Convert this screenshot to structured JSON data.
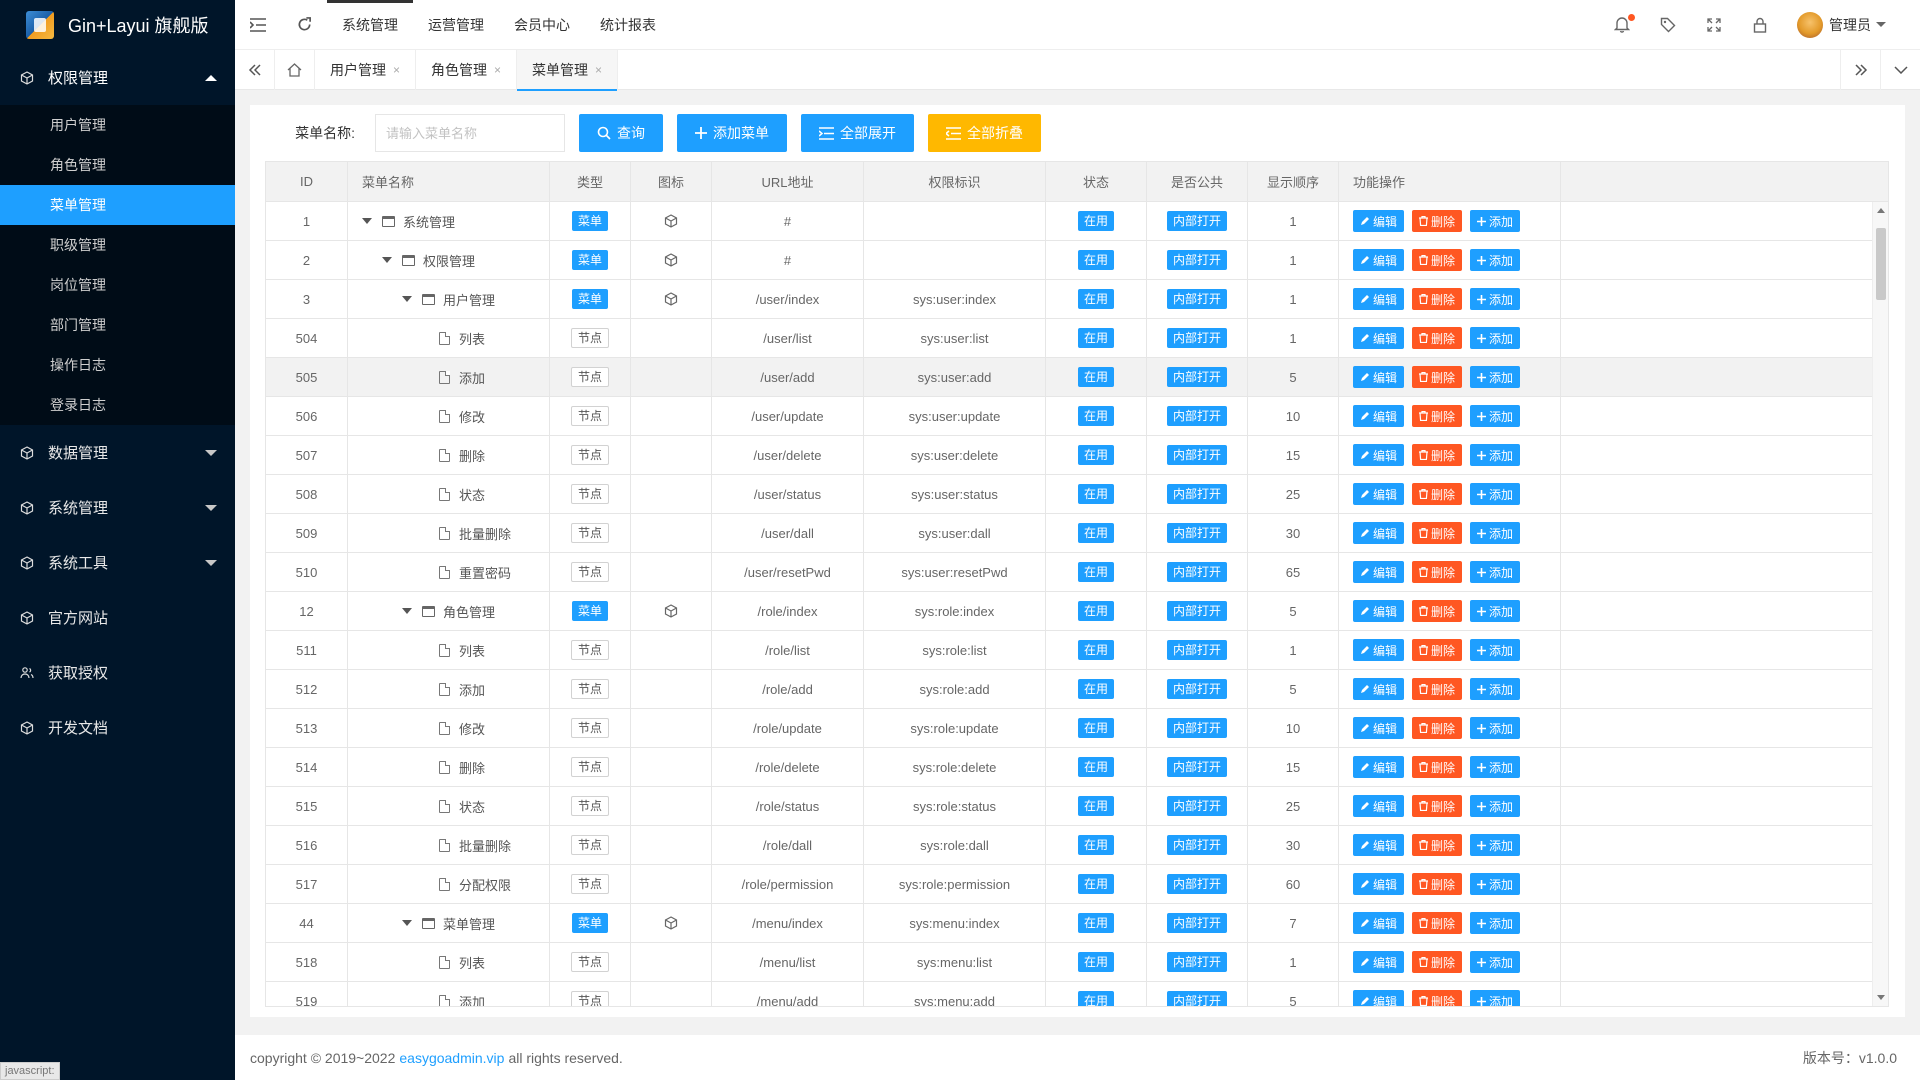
{
  "app": {
    "title": "Gin+Layui 旗舰版"
  },
  "sidebar": {
    "groups": [
      {
        "label": "权限管理",
        "icon": "cube-icon",
        "expanded": true,
        "items": [
          "用户管理",
          "角色管理",
          "菜单管理",
          "职级管理",
          "岗位管理",
          "部门管理",
          "操作日志",
          "登录日志"
        ],
        "active": "菜单管理"
      },
      {
        "label": "数据管理",
        "icon": "cube-icon",
        "expanded": false
      },
      {
        "label": "系统管理",
        "icon": "cube-icon",
        "expanded": false
      },
      {
        "label": "系统工具",
        "icon": "cube-icon",
        "expanded": false
      },
      {
        "label": "官方网站",
        "icon": "cube-icon"
      },
      {
        "label": "获取授权",
        "icon": "users-icon"
      },
      {
        "label": "开发文档",
        "icon": "cube-icon"
      }
    ],
    "status_text": "javascript:"
  },
  "header": {
    "nav": [
      "系统管理",
      "运营管理",
      "会员中心",
      "统计报表"
    ],
    "active_nav": "系统管理",
    "user": "管理员"
  },
  "tabs": {
    "items": [
      {
        "label": "用户管理",
        "close": "×"
      },
      {
        "label": "角色管理",
        "close": "×"
      },
      {
        "label": "菜单管理",
        "close": "×",
        "active": true
      }
    ]
  },
  "search": {
    "label": "菜单名称:",
    "placeholder": "请输入菜单名称",
    "buttons": {
      "query": "查询",
      "add": "添加菜单",
      "expand": "全部展开",
      "collapse": "全部折叠"
    }
  },
  "table": {
    "columns": [
      "ID",
      "菜单名称",
      "类型",
      "图标",
      "URL地址",
      "权限标识",
      "状态",
      "是否公共",
      "显示顺序",
      "功能操作"
    ],
    "actions": {
      "edit": "编辑",
      "delete": "删除",
      "add": "添加"
    },
    "rows": [
      {
        "id": "1",
        "name": "系统管理",
        "level": 0,
        "kind": "folder",
        "type": "菜单",
        "icon": true,
        "url": "#",
        "perm": "",
        "status": "在用",
        "public": "内部打开",
        "order": "1"
      },
      {
        "id": "2",
        "name": "权限管理",
        "level": 1,
        "kind": "folder",
        "type": "菜单",
        "icon": true,
        "url": "#",
        "perm": "",
        "status": "在用",
        "public": "内部打开",
        "order": "1"
      },
      {
        "id": "3",
        "name": "用户管理",
        "level": 2,
        "kind": "folder",
        "type": "菜单",
        "icon": true,
        "url": "/user/index",
        "perm": "sys:user:index",
        "status": "在用",
        "public": "内部打开",
        "order": "1"
      },
      {
        "id": "504",
        "name": "列表",
        "level": 3,
        "kind": "file",
        "type": "节点",
        "icon": false,
        "url": "/user/list",
        "perm": "sys:user:list",
        "status": "在用",
        "public": "内部打开",
        "order": "1"
      },
      {
        "id": "505",
        "name": "添加",
        "level": 3,
        "kind": "file",
        "type": "节点",
        "icon": false,
        "url": "/user/add",
        "perm": "sys:user:add",
        "status": "在用",
        "public": "内部打开",
        "order": "5",
        "hover": true
      },
      {
        "id": "506",
        "name": "修改",
        "level": 3,
        "kind": "file",
        "type": "节点",
        "icon": false,
        "url": "/user/update",
        "perm": "sys:user:update",
        "status": "在用",
        "public": "内部打开",
        "order": "10"
      },
      {
        "id": "507",
        "name": "删除",
        "level": 3,
        "kind": "file",
        "type": "节点",
        "icon": false,
        "url": "/user/delete",
        "perm": "sys:user:delete",
        "status": "在用",
        "public": "内部打开",
        "order": "15"
      },
      {
        "id": "508",
        "name": "状态",
        "level": 3,
        "kind": "file",
        "type": "节点",
        "icon": false,
        "url": "/user/status",
        "perm": "sys:user:status",
        "status": "在用",
        "public": "内部打开",
        "order": "25"
      },
      {
        "id": "509",
        "name": "批量删除",
        "level": 3,
        "kind": "file",
        "type": "节点",
        "icon": false,
        "url": "/user/dall",
        "perm": "sys:user:dall",
        "status": "在用",
        "public": "内部打开",
        "order": "30"
      },
      {
        "id": "510",
        "name": "重置密码",
        "level": 3,
        "kind": "file",
        "type": "节点",
        "icon": false,
        "url": "/user/resetPwd",
        "perm": "sys:user:resetPwd",
        "status": "在用",
        "public": "内部打开",
        "order": "65"
      },
      {
        "id": "12",
        "name": "角色管理",
        "level": 2,
        "kind": "folder",
        "type": "菜单",
        "icon": true,
        "url": "/role/index",
        "perm": "sys:role:index",
        "status": "在用",
        "public": "内部打开",
        "order": "5"
      },
      {
        "id": "511",
        "name": "列表",
        "level": 3,
        "kind": "file",
        "type": "节点",
        "icon": false,
        "url": "/role/list",
        "perm": "sys:role:list",
        "status": "在用",
        "public": "内部打开",
        "order": "1"
      },
      {
        "id": "512",
        "name": "添加",
        "level": 3,
        "kind": "file",
        "type": "节点",
        "icon": false,
        "url": "/role/add",
        "perm": "sys:role:add",
        "status": "在用",
        "public": "内部打开",
        "order": "5"
      },
      {
        "id": "513",
        "name": "修改",
        "level": 3,
        "kind": "file",
        "type": "节点",
        "icon": false,
        "url": "/role/update",
        "perm": "sys:role:update",
        "status": "在用",
        "public": "内部打开",
        "order": "10"
      },
      {
        "id": "514",
        "name": "删除",
        "level": 3,
        "kind": "file",
        "type": "节点",
        "icon": false,
        "url": "/role/delete",
        "perm": "sys:role:delete",
        "status": "在用",
        "public": "内部打开",
        "order": "15"
      },
      {
        "id": "515",
        "name": "状态",
        "level": 3,
        "kind": "file",
        "type": "节点",
        "icon": false,
        "url": "/role/status",
        "perm": "sys:role:status",
        "status": "在用",
        "public": "内部打开",
        "order": "25"
      },
      {
        "id": "516",
        "name": "批量删除",
        "level": 3,
        "kind": "file",
        "type": "节点",
        "icon": false,
        "url": "/role/dall",
        "perm": "sys:role:dall",
        "status": "在用",
        "public": "内部打开",
        "order": "30"
      },
      {
        "id": "517",
        "name": "分配权限",
        "level": 3,
        "kind": "file",
        "type": "节点",
        "icon": false,
        "url": "/role/permission",
        "perm": "sys:role:permission",
        "status": "在用",
        "public": "内部打开",
        "order": "60"
      },
      {
        "id": "44",
        "name": "菜单管理",
        "level": 2,
        "kind": "folder",
        "type": "菜单",
        "icon": true,
        "url": "/menu/index",
        "perm": "sys:menu:index",
        "status": "在用",
        "public": "内部打开",
        "order": "7"
      },
      {
        "id": "518",
        "name": "列表",
        "level": 3,
        "kind": "file",
        "type": "节点",
        "icon": false,
        "url": "/menu/list",
        "perm": "sys:menu:list",
        "status": "在用",
        "public": "内部打开",
        "order": "1"
      },
      {
        "id": "519",
        "name": "添加",
        "level": 3,
        "kind": "file",
        "type": "节点",
        "icon": false,
        "url": "/menu/add",
        "perm": "sys:menu:add",
        "status": "在用",
        "public": "内部打开",
        "order": "5"
      }
    ]
  },
  "footer": {
    "copyright_prefix": "copyright © 2019~2022 ",
    "link": "easygoadmin.vip",
    "copyright_suffix": " all rights reserved.",
    "version": "版本号：v1.0.0"
  },
  "colors": {
    "sidebar_bg": "#001529",
    "primary": "#1e9fff",
    "warning": "#ffb800",
    "danger": "#ff5722"
  }
}
